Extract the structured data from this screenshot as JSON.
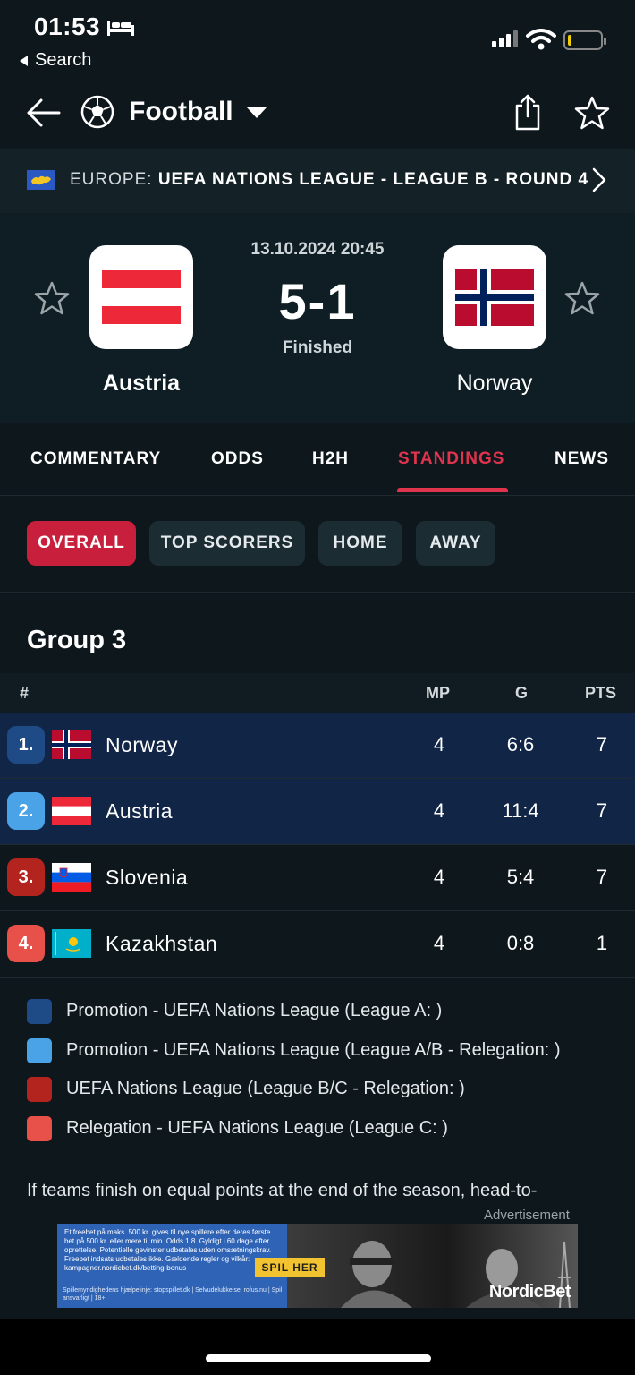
{
  "status_bar": {
    "time": "01:53",
    "back_label": "Search"
  },
  "header": {
    "sport": "Football"
  },
  "league": {
    "country": "EUROPE:",
    "name": "UEFA NATIONS LEAGUE - LEAGUE B - ROUND 4"
  },
  "match": {
    "datetime": "13.10.2024 20:45",
    "score": "5-1",
    "status": "Finished",
    "home": {
      "name": "Austria"
    },
    "away": {
      "name": "Norway"
    }
  },
  "tabs": [
    {
      "label": "COMMENTARY"
    },
    {
      "label": "ODDS"
    },
    {
      "label": "H2H"
    },
    {
      "label": "STANDINGS"
    },
    {
      "label": "NEWS"
    }
  ],
  "chips": [
    {
      "label": "OVERALL"
    },
    {
      "label": "TOP SCORERS"
    },
    {
      "label": "HOME"
    },
    {
      "label": "AWAY"
    }
  ],
  "group": {
    "title": "Group 3",
    "columns": {
      "rank": "#",
      "mp": "MP",
      "g": "G",
      "pts": "PTS"
    },
    "rows": [
      {
        "rank": "1.",
        "team": "Norway",
        "mp": "4",
        "g": "6:6",
        "pts": "7",
        "color": "#1e4a86"
      },
      {
        "rank": "2.",
        "team": "Austria",
        "mp": "4",
        "g": "11:4",
        "pts": "7",
        "color": "#4aa3e6"
      },
      {
        "rank": "3.",
        "team": "Slovenia",
        "mp": "4",
        "g": "5:4",
        "pts": "7",
        "color": "#b3241f"
      },
      {
        "rank": "4.",
        "team": "Kazakhstan",
        "mp": "4",
        "g": "0:8",
        "pts": "1",
        "color": "#e8504a"
      }
    ]
  },
  "legend": [
    {
      "text": "Promotion - UEFA Nations League (League A: )",
      "color": "#1e4a86"
    },
    {
      "text": "Promotion - UEFA Nations League (League A/B - Relegation: )",
      "color": "#4aa3e6"
    },
    {
      "text": "UEFA Nations League (League B/C - Relegation: )",
      "color": "#b3241f"
    },
    {
      "text": "Relegation - UEFA Nations League (League C: )",
      "color": "#e8504a"
    }
  ],
  "note": "If teams finish on equal points at the end of the season, head-to-",
  "advertisement": {
    "label": "Advertisement",
    "fineprint": "Et freebet på maks. 500 kr. gives til nye spillere efter deres første bet på 500 kr. eller mere til min. Odds 1.8. Gyldigt i 60 dage efter oprettelse. Potentielle gevinster udbetales uden omsætningskrav. Freebet indsats udbetales ikke. Gældende regler og vilkår: kampagner.nordicbet.dk/betting-bonus",
    "footer": "Spillemyndighedens hjælpelinje: stopspillet.dk | Selvudelukkelse: rofus.nu | Spil ansvarligt | 18+",
    "cta": "SPIL HER",
    "brand": "NordicBet"
  }
}
